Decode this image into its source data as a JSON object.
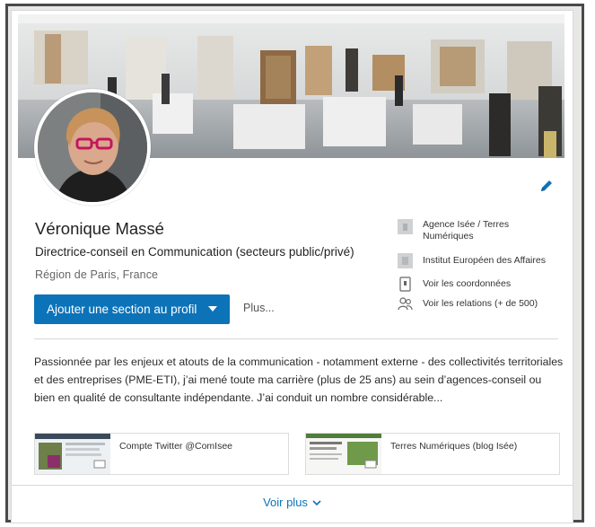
{
  "profile": {
    "name": "Véronique Massé",
    "headline": "Directrice-conseil en Communication (secteurs public/privé)",
    "location": "Région de Paris, France"
  },
  "actions": {
    "add_section_label": "Ajouter une section au profil",
    "more_label": "Plus..."
  },
  "sidebar": {
    "company": "Agence Isée / Terres Numériques",
    "school": "Institut Européen des Affaires",
    "contact_label": "Voir les coordonnées",
    "connections_label": "Voir les relations (+ de 500)"
  },
  "summary": {
    "text": "Passionnée par les enjeux et atouts de la communication - notamment externe - des collectivités territoriales et des entreprises (PME-ETI), j’ai mené toute ma carrière (plus de 25 ans) au sein d’agences-conseil ou bien en qualité de consultante indépendante. J’ai conduit un nombre considérable..."
  },
  "media": [
    {
      "label": "Compte Twitter @ComIsee",
      "icon": "twitter-thumbnail"
    },
    {
      "label": "Terres Numériques (blog Isée)",
      "icon": "blog-thumbnail"
    }
  ],
  "footer": {
    "see_more_label": "Voir plus"
  },
  "colors": {
    "accent": "#0c73b8",
    "frame": "#4a4a4a"
  }
}
